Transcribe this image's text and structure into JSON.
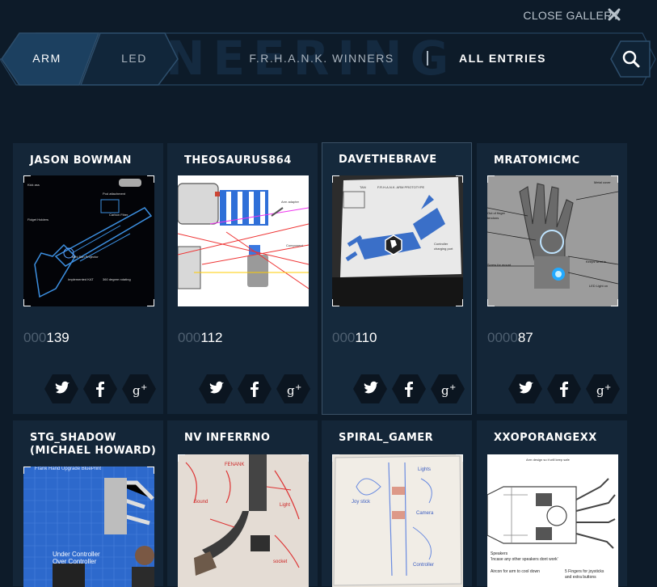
{
  "header": {
    "close_label": "CLOSE GALLERY",
    "bg_title": "NEERING"
  },
  "nav": {
    "tabs": [
      {
        "label": "ARM"
      },
      {
        "label": "LED"
      },
      {
        "label": "F.R.H.A.N.K. WINNERS"
      },
      {
        "label": "ALL ENTRIES"
      }
    ]
  },
  "cards": [
    {
      "name": "JASON BOWMAN",
      "zeros": "000",
      "score": "139"
    },
    {
      "name": "THEOSAURUS864",
      "zeros": "000",
      "score": "112"
    },
    {
      "name": "DAVETHEBRAVE",
      "zeros": "000",
      "score": "110"
    },
    {
      "name": "MRATOMICMC",
      "zeros": "0000",
      "score": "87"
    },
    {
      "name": "STG_SHADOW (MICHAEL HOWARD)"
    },
    {
      "name": "NV INFERRNO"
    },
    {
      "name": "SPIRAL_GAMER"
    },
    {
      "name": "XXOPORANGEXX"
    }
  ],
  "thumb_text": {
    "t1": [
      "Kick ass",
      "Fidget Holders",
      "Pod attachment",
      "Carbon Fiber",
      "Mini Sun Projector",
      "Implemented KAT",
      "360 degree rotating"
    ],
    "t2": [
      "Arm adapter",
      "Component"
    ],
    "t3": [
      "TAN",
      "F.R.H.A.N.K. ARM PROTOTYPE",
      "Controller",
      "charging port"
    ],
    "t4": [
      "Metal cover",
      "Out of finger",
      "tendons",
      "Keeps wrist in",
      "LED Light on",
      "Screw for mount"
    ],
    "t5": [
      "Frank Hand Upgrade BluePrint",
      "Under Controller",
      "Over Controller"
    ],
    "t6": [
      "FENANK",
      "Sound",
      "Light",
      "socket"
    ],
    "t7": [
      "Joy stick",
      "Lights",
      "Camera",
      "Controller"
    ],
    "t8": [
      "Arm design so it will keep safe",
      "Speakers",
      "'Incase any other speakers dont work'",
      "Aircon for arm to cool down",
      "5 Fingers for joysticks",
      "and extra buttons"
    ]
  },
  "icons": {
    "twitter": "twitter-icon",
    "facebook": "facebook-icon",
    "google": "google-plus-icon"
  },
  "colors": {
    "background": "#0d1b29",
    "card": "#142638",
    "tab_active": "#1c4060",
    "tab_border": "#2d4e6c"
  }
}
